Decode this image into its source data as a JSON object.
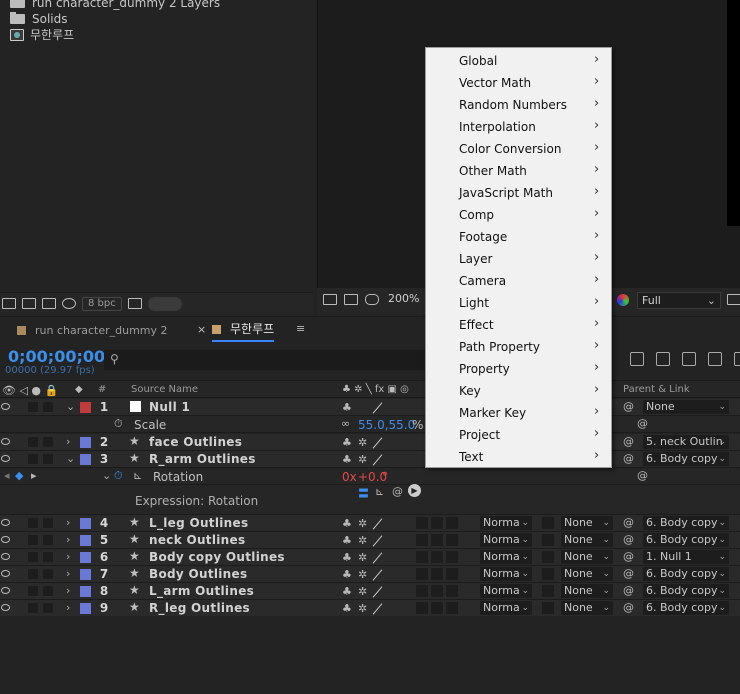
{
  "project": {
    "items": [
      {
        "label": "run character_dummy 2 Layers",
        "icon": "folder-icon"
      },
      {
        "label": "Solids",
        "icon": "folder-icon"
      },
      {
        "label": "무한루프",
        "icon": "composition-icon"
      }
    ],
    "bpc": "8 bpc"
  },
  "viewer": {
    "zoom": "200%",
    "resolution": "Full"
  },
  "tabs": [
    {
      "label": "run character_dummy 2",
      "active": false,
      "color": "#a88a5e"
    },
    {
      "label": "무한루프",
      "active": true,
      "color": "#c7a06d"
    }
  ],
  "timeline": {
    "timecode": "0;00;00;00",
    "frames": "00000 (29.97 fps)",
    "columns": {
      "hash": "#",
      "source_name": "Source Name",
      "parent": "Parent & Link"
    },
    "layers": [
      {
        "num": "1",
        "name": "Null 1",
        "color": "#c03b3b",
        "type": "null",
        "mode": "",
        "trkmat": "",
        "parent": "None"
      },
      {
        "num": "2",
        "name": "face Outlines",
        "color": "#6b79d6",
        "type": "shape",
        "mode": "",
        "trkmat": "",
        "parent": "5. neck Outlin"
      },
      {
        "num": "3",
        "name": "R_arm Outlines",
        "color": "#6b79d6",
        "type": "shape",
        "mode": "",
        "trkmat": "",
        "parent": "6. Body copy"
      },
      {
        "num": "4",
        "name": "L_leg Outlines",
        "color": "#6b79d6",
        "type": "shape",
        "mode": "Norma",
        "trkmat": "None",
        "parent": "6. Body copy"
      },
      {
        "num": "5",
        "name": "neck Outlines",
        "color": "#6b79d6",
        "type": "shape",
        "mode": "Norma",
        "trkmat": "None",
        "parent": "6. Body copy"
      },
      {
        "num": "6",
        "name": "Body copy Outlines",
        "color": "#6b79d6",
        "type": "shape",
        "mode": "Norma",
        "trkmat": "None",
        "parent": "1. Null 1"
      },
      {
        "num": "7",
        "name": "Body Outlines",
        "color": "#6b79d6",
        "type": "shape",
        "mode": "Norma",
        "trkmat": "None",
        "parent": "6. Body copy"
      },
      {
        "num": "8",
        "name": "L_arm Outlines",
        "color": "#6b79d6",
        "type": "shape",
        "mode": "Norma",
        "trkmat": "None",
        "parent": "6. Body copy"
      },
      {
        "num": "9",
        "name": "R_leg Outlines",
        "color": "#6b79d6",
        "type": "shape",
        "mode": "Norma",
        "trkmat": "None",
        "parent": "6. Body copy"
      }
    ],
    "scale": {
      "label": "Scale",
      "value": "55.0,55.0",
      "unit": "%"
    },
    "rotation": {
      "label": "Rotation",
      "value_x": "0x",
      "value_deg": "+0.0",
      "unit": "°"
    },
    "expression": {
      "label": "Expression: Rotation"
    }
  },
  "menu": {
    "items": [
      "Global",
      "Vector Math",
      "Random Numbers",
      "Interpolation",
      "Color Conversion",
      "Other Math",
      "JavaScript Math",
      "Comp",
      "Footage",
      "Layer",
      "Camera",
      "Light",
      "Effect",
      "Path Property",
      "Property",
      "Key",
      "Marker Key",
      "Project",
      "Text"
    ]
  }
}
